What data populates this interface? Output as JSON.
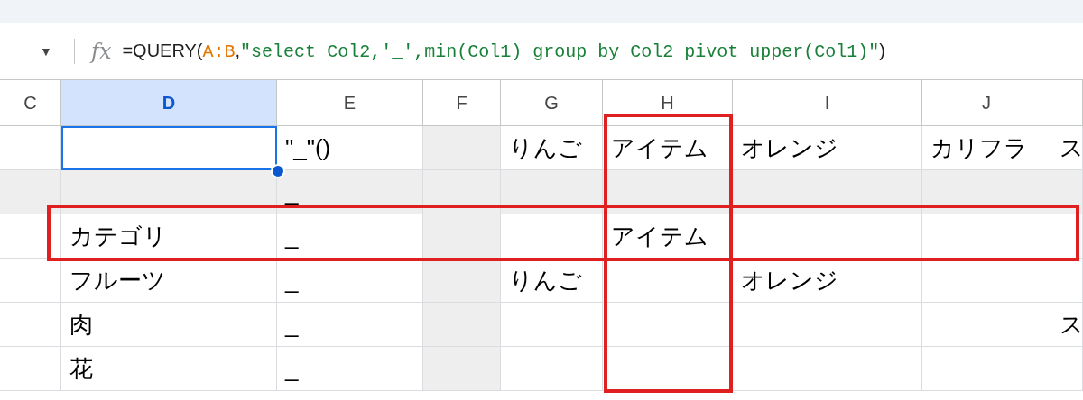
{
  "formula_bar": {
    "dropdown": "▼",
    "function_label": "fx",
    "segments": [
      {
        "kind": "plain",
        "text": "=QUERY("
      },
      {
        "kind": "range",
        "text": "A:B"
      },
      {
        "kind": "plain",
        "text": ","
      },
      {
        "kind": "string",
        "text": "\"select Col2,'_',min(Col1) group by Col2 pivot upper(Col1)\""
      },
      {
        "kind": "plain",
        "text": ")"
      }
    ]
  },
  "columns": [
    {
      "label": "C",
      "selected": false,
      "shaded": false,
      "framed": false
    },
    {
      "label": "D",
      "selected": true,
      "shaded": false,
      "framed": false
    },
    {
      "label": "E",
      "selected": false,
      "shaded": false,
      "framed": false
    },
    {
      "label": "F",
      "selected": false,
      "shaded": true,
      "framed": false
    },
    {
      "label": "G",
      "selected": false,
      "shaded": false,
      "framed": false
    },
    {
      "label": "H",
      "selected": false,
      "shaded": false,
      "framed": true
    },
    {
      "label": "I",
      "selected": false,
      "shaded": false,
      "framed": false
    },
    {
      "label": "J",
      "selected": false,
      "shaded": false,
      "framed": false
    },
    {
      "selected": false,
      "shaded": false,
      "framed": false
    }
  ],
  "rows": [
    {
      "selected": true,
      "shaded": false,
      "framed": false,
      "cells": {
        "E": "\"_\"()",
        "G": "りんご",
        "H": "アイテム",
        "I": "オレンジ",
        "J": "カリフラ",
        "K": "ス"
      }
    },
    {
      "selected": false,
      "shaded": true,
      "framed": false,
      "cells": {
        "E": "_"
      }
    },
    {
      "selected": false,
      "shaded": false,
      "framed": true,
      "cells": {
        "D": "カテゴリ",
        "E": "_",
        "H": "アイテム"
      }
    },
    {
      "selected": false,
      "shaded": false,
      "framed": false,
      "cells": {
        "D": "フルーツ",
        "E": "_",
        "G": "りんご",
        "I": "オレンジ"
      }
    },
    {
      "selected": false,
      "shaded": false,
      "framed": false,
      "cells": {
        "D": "肉",
        "E": "_",
        "K": "ス"
      }
    },
    {
      "selected": false,
      "shaded": false,
      "framed": false,
      "cells": {
        "D": "花",
        "E": "_"
      }
    }
  ]
}
